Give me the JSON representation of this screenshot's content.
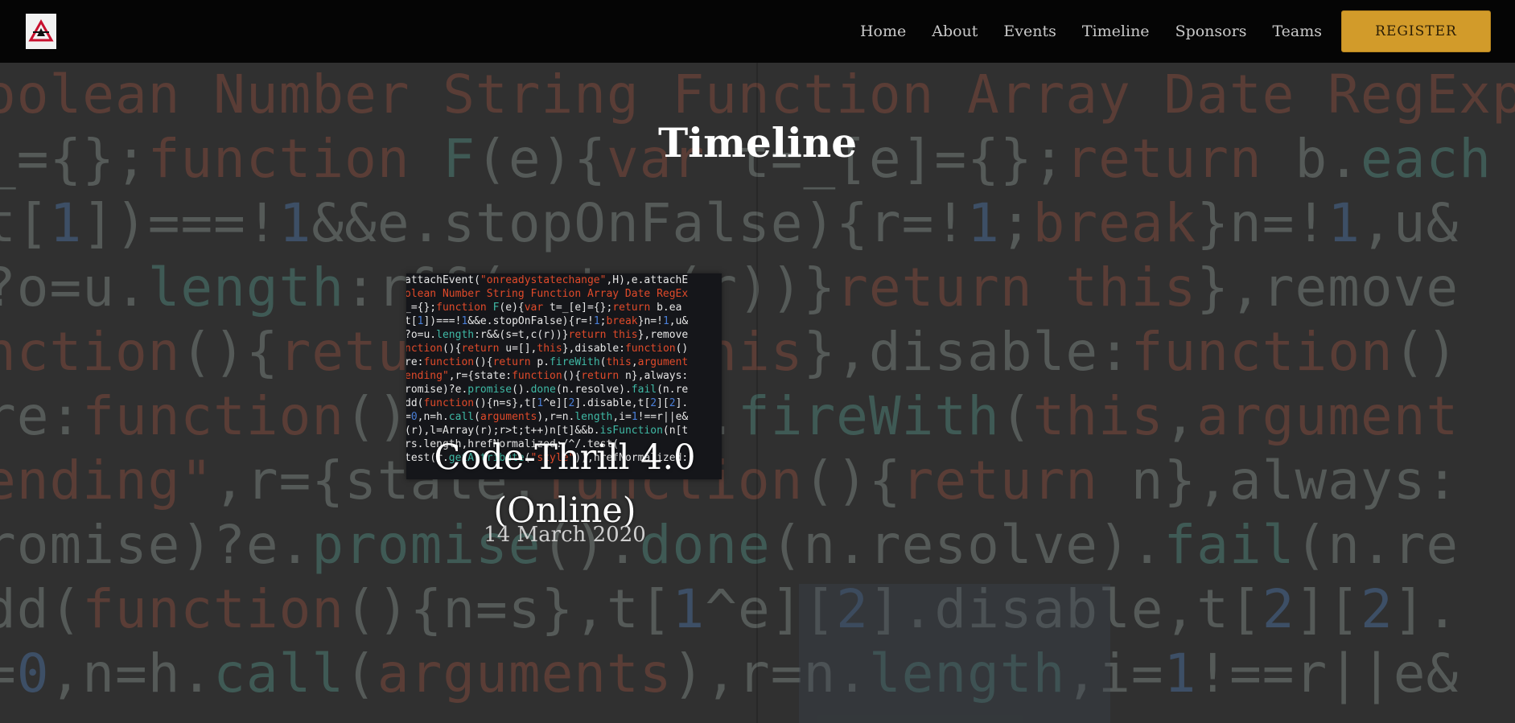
{
  "navbar": {
    "logo_icon": "triangle-logo-icon",
    "links": [
      "Home",
      "About",
      "Events",
      "Timeline",
      "Sponsors",
      "Teams"
    ],
    "register_label": "REGISTER",
    "accent_color": "#d29b2a"
  },
  "main": {
    "page_title": "Timeline",
    "events": [
      {
        "title": "Code-Thrill 4.0 (Online)",
        "date": "14 March 2020"
      }
    ]
  }
}
